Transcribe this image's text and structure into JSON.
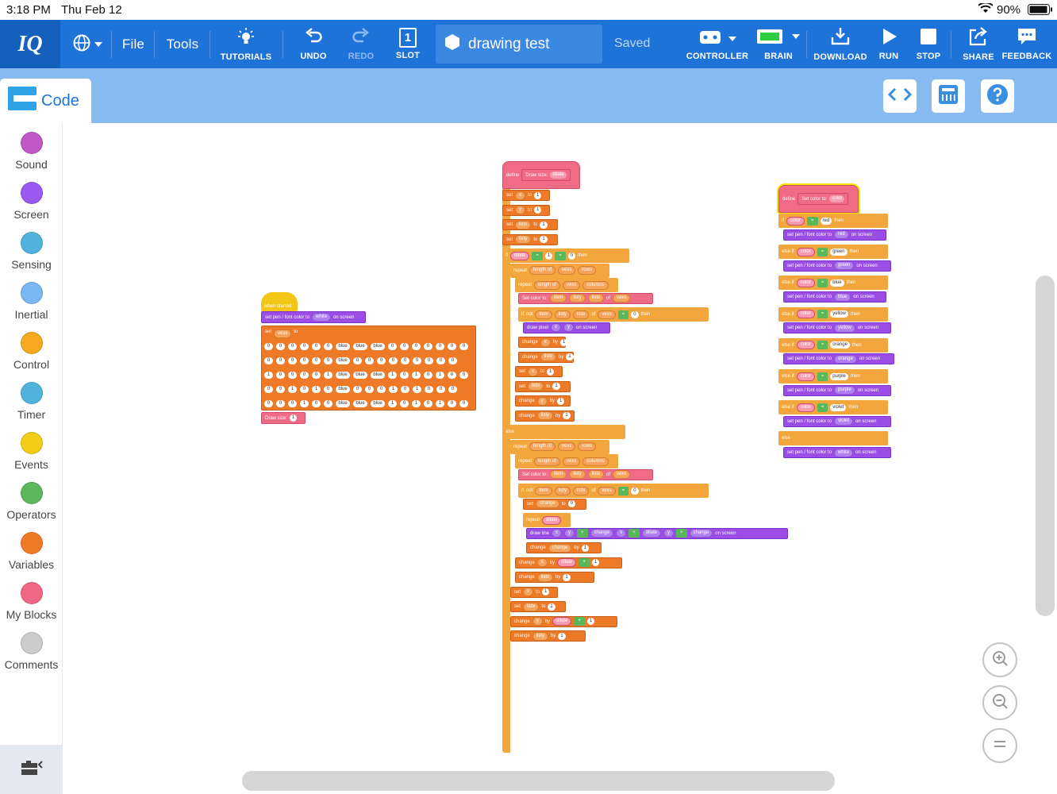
{
  "status": {
    "time": "3:18 PM",
    "date": "Thu Feb 12",
    "battery": "90%"
  },
  "toolbar": {
    "logo": "IQ",
    "file": "File",
    "tools": "Tools",
    "tutorials": "TUTORIALS",
    "undo": "UNDO",
    "redo": "REDO",
    "slot": "SLOT",
    "slot_number": "1",
    "project_name": "drawing test",
    "saved": "Saved",
    "controller": "CONTROLLER",
    "brain": "BRAIN",
    "download": "DOWNLOAD",
    "run": "RUN",
    "stop": "STOP",
    "share": "SHARE",
    "feedback": "FEEDBACK"
  },
  "code_tab": "Code",
  "categories": [
    {
      "label": "Sound",
      "color": "#c058c7"
    },
    {
      "label": "Screen",
      "color": "#9b59f0"
    },
    {
      "label": "Sensing",
      "color": "#4fb3dd"
    },
    {
      "label": "Inertial",
      "color": "#7ab8f5"
    },
    {
      "label": "Control",
      "color": "#f6a821"
    },
    {
      "label": "Timer",
      "color": "#4fb3dd"
    },
    {
      "label": "Events",
      "color": "#f2cd17"
    },
    {
      "label": "Operators",
      "color": "#5cb85c"
    },
    {
      "label": "Variables",
      "color": "#ee7a27"
    },
    {
      "label": "My Blocks",
      "color": "#ef6784"
    },
    {
      "label": "Comments",
      "color": "#cccccc"
    }
  ],
  "stack1": {
    "hat": "when started",
    "line1": [
      "set pen / font color to",
      "white",
      "on screen"
    ],
    "set_var": [
      "set",
      "vexs",
      "to"
    ],
    "grid": [
      [
        "0",
        "0",
        "0",
        "0",
        "0",
        "0",
        "blue",
        "blue",
        "blue",
        "0",
        "0",
        "0",
        "0",
        "0",
        "0",
        "0"
      ],
      [
        "0",
        "0",
        "0",
        "0",
        "0",
        "0",
        "blue",
        "0",
        "0",
        "0",
        "0",
        "0",
        "0",
        "0",
        "0",
        "0"
      ],
      [
        "1",
        "0",
        "0",
        "0",
        "0",
        "1",
        "blue",
        "blue",
        "blue",
        "1",
        "0",
        "1",
        "0",
        "1",
        "0",
        "0"
      ],
      [
        "0",
        "0",
        "1",
        "0",
        "1",
        "0",
        "blue",
        "0",
        "0",
        "0",
        "1",
        "0",
        "1",
        "0",
        "0",
        "0"
      ],
      [
        "0",
        "0",
        "0",
        "1",
        "0",
        "0",
        "blue",
        "blue",
        "blue",
        "1",
        "0",
        "1",
        "0",
        "1",
        "0",
        "0"
      ]
    ],
    "draw_call": [
      "Draw size:",
      "1"
    ]
  },
  "stack2": {
    "define": [
      "define",
      "Draw size:",
      "dilate"
    ],
    "rows": [
      {
        "c": "o",
        "t": [
          "set",
          "x",
          "to",
          "1"
        ]
      },
      {
        "c": "o",
        "t": [
          "set",
          "y",
          "to",
          "1"
        ]
      },
      {
        "c": "o",
        "t": [
          "set",
          "listx",
          "to",
          "1"
        ]
      },
      {
        "c": "o",
        "t": [
          "set",
          "listy",
          "to",
          "1"
        ]
      },
      {
        "c": "oc",
        "t": [
          "if",
          "dilate",
          "=",
          "1",
          "=",
          "0",
          "then"
        ]
      },
      {
        "c": "oc",
        "t": [
          "repeat",
          "length of",
          "vexs",
          "rows"
        ]
      },
      {
        "c": "oc",
        "t": [
          "repeat",
          "length of",
          "vexs",
          "columns"
        ]
      },
      {
        "c": "pk",
        "t": [
          "Set color to:",
          "item",
          "listy",
          "listx",
          "of",
          "vexs"
        ]
      },
      {
        "c": "oc",
        "t": [
          "if",
          "not",
          "item",
          "listy",
          "listx",
          "of",
          "vexs",
          "=",
          "0",
          "then"
        ]
      },
      {
        "c": "pu",
        "t": [
          "draw pixel",
          "x",
          "y",
          "on screen"
        ]
      },
      {
        "c": "o",
        "t": [
          "change",
          "x",
          "by",
          "1"
        ]
      },
      {
        "c": "o",
        "t": [
          "change",
          "listx",
          "by",
          "1"
        ]
      },
      {
        "c": "o",
        "t": [
          "set",
          "x",
          "to",
          "1"
        ]
      },
      {
        "c": "o",
        "t": [
          "set",
          "listx",
          "to",
          "1"
        ]
      },
      {
        "c": "o",
        "t": [
          "change",
          "y",
          "by",
          "1"
        ]
      },
      {
        "c": "o",
        "t": [
          "change",
          "listy",
          "by",
          "1"
        ]
      },
      {
        "c": "oc",
        "t": [
          "else"
        ]
      },
      {
        "c": "oc",
        "t": [
          "repeat",
          "length of",
          "vexs",
          "rows"
        ]
      },
      {
        "c": "oc",
        "t": [
          "repeat",
          "length of",
          "vexs",
          "columns"
        ]
      },
      {
        "c": "pk",
        "t": [
          "Set color to:",
          "item",
          "listy",
          "listx",
          "of",
          "vexs"
        ]
      },
      {
        "c": "oc",
        "t": [
          "if",
          "not",
          "item",
          "listy",
          "listx",
          "of",
          "vexs",
          "=",
          "0",
          "then"
        ]
      },
      {
        "c": "o",
        "t": [
          "set",
          "change",
          "to",
          "0"
        ]
      },
      {
        "c": "oc",
        "t": [
          "repeat",
          "dilate"
        ]
      },
      {
        "c": "pu",
        "t": [
          "draw line",
          "x",
          "y",
          "+",
          "change",
          "x",
          "+",
          "dilate",
          "y",
          "+",
          "change",
          "on screen"
        ]
      },
      {
        "c": "o",
        "t": [
          "change",
          "change",
          "by",
          "1"
        ]
      },
      {
        "c": "o",
        "t": [
          "change",
          "x",
          "by",
          "dilate",
          "+",
          "1"
        ]
      },
      {
        "c": "o",
        "t": [
          "change",
          "listx",
          "by",
          "1"
        ]
      },
      {
        "c": "o",
        "t": [
          "set",
          "x",
          "to",
          "1"
        ]
      },
      {
        "c": "o",
        "t": [
          "set",
          "listx",
          "to",
          "1"
        ]
      },
      {
        "c": "o",
        "t": [
          "change",
          "y",
          "by",
          "dilate",
          "+",
          "1"
        ]
      },
      {
        "c": "o",
        "t": [
          "change",
          "listy",
          "by",
          "1"
        ]
      }
    ]
  },
  "stack3": {
    "define": [
      "define",
      "Set color to:",
      "color"
    ],
    "rows": [
      {
        "c": "oc",
        "t": [
          "if",
          "color",
          "=",
          "red",
          "then"
        ]
      },
      {
        "c": "pu",
        "t": [
          "set pen / font color to",
          "red",
          "on screen"
        ]
      },
      {
        "c": "oc",
        "t": [
          "else if",
          "color",
          "=",
          "green",
          "then"
        ]
      },
      {
        "c": "pu",
        "t": [
          "set pen / font color to",
          "green",
          "on screen"
        ]
      },
      {
        "c": "oc",
        "t": [
          "else if",
          "color",
          "=",
          "blue",
          "then"
        ]
      },
      {
        "c": "pu",
        "t": [
          "set pen / font color to",
          "blue",
          "on screen"
        ]
      },
      {
        "c": "oc",
        "t": [
          "else if",
          "color",
          "=",
          "yellow",
          "then"
        ]
      },
      {
        "c": "pu",
        "t": [
          "set pen / font color to",
          "yellow",
          "on screen"
        ]
      },
      {
        "c": "oc",
        "t": [
          "else if",
          "color",
          "=",
          "orange",
          "then"
        ]
      },
      {
        "c": "pu",
        "t": [
          "set pen / font color to",
          "orange",
          "on screen"
        ]
      },
      {
        "c": "oc",
        "t": [
          "else if",
          "color",
          "=",
          "purple",
          "then"
        ]
      },
      {
        "c": "pu",
        "t": [
          "set pen / font color to",
          "purple",
          "on screen"
        ]
      },
      {
        "c": "oc",
        "t": [
          "else if",
          "color",
          "=",
          "violet",
          "then"
        ]
      },
      {
        "c": "pu",
        "t": [
          "set pen / font color to",
          "violet",
          "on screen"
        ]
      },
      {
        "c": "oc",
        "t": [
          "else"
        ]
      },
      {
        "c": "pu",
        "t": [
          "set pen / font color to",
          "white",
          "on screen"
        ]
      }
    ]
  }
}
